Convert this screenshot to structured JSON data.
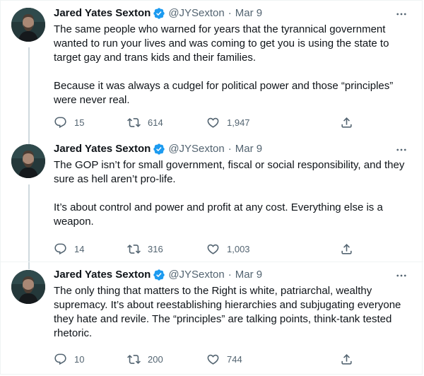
{
  "colors": {
    "text": "#0f1419",
    "secondary": "#536471",
    "verified": "#1d9bf0",
    "thread_line": "#cfd9de",
    "border": "#eff3f4"
  },
  "icons": {
    "verified": "verified-badge-icon",
    "more": "more-horizontal-icon",
    "reply": "reply-bubble-icon",
    "retweet": "retweet-arrows-icon",
    "like": "heart-icon",
    "share": "share-upload-icon"
  },
  "tweets": [
    {
      "author": {
        "name": "Jared Yates Sexton",
        "handle": "@JYSexton",
        "separator": "·",
        "date": "Mar 9"
      },
      "paragraphs": [
        "The same people who warned for years that the tyrannical government wanted to run your lives and was coming to get you is using the state to target gay and trans kids and their families.",
        "Because it was always a cudgel for political power and those “principles” were never real."
      ],
      "stats": {
        "replies": "15",
        "retweets": "614",
        "likes": "1,947"
      }
    },
    {
      "author": {
        "name": "Jared Yates Sexton",
        "handle": "@JYSexton",
        "separator": "·",
        "date": "Mar 9"
      },
      "paragraphs": [
        "The GOP isn’t for small government, fiscal or social responsibility, and they sure as hell aren’t pro-life.",
        "It’s about control and power and profit at any cost. Everything else is a weapon."
      ],
      "stats": {
        "replies": "14",
        "retweets": "316",
        "likes": "1,003"
      }
    },
    {
      "author": {
        "name": "Jared Yates Sexton",
        "handle": "@JYSexton",
        "separator": "·",
        "date": "Mar 9"
      },
      "paragraphs": [
        "The only thing that matters to the Right is white, patriarchal, wealthy supremacy. It’s about reestablishing hierarchies and subjugating everyone they hate and revile. The “principles” are talking points, think-tank tested rhetoric."
      ],
      "stats": {
        "replies": "10",
        "retweets": "200",
        "likes": "744"
      }
    }
  ]
}
